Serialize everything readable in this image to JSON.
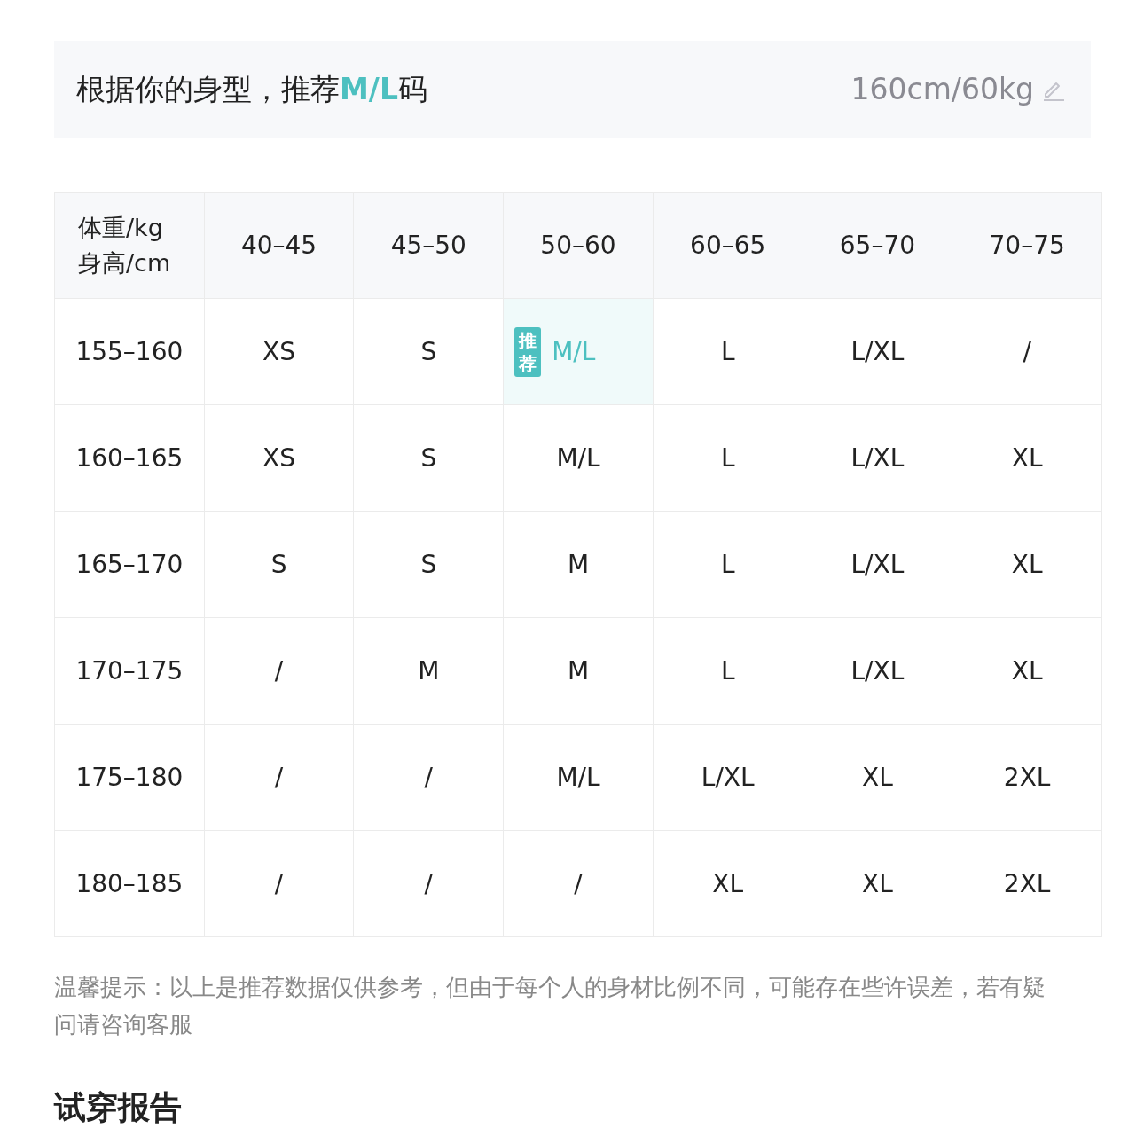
{
  "recommendation": {
    "text": "根据你的身型，推荐**M/L**码",
    "body": "160cm/60kg"
  },
  "size_table": {
    "corner": [
      "体重/kg",
      "身高/cm"
    ],
    "columns": [
      "40–45",
      "45–50",
      "50–60",
      "60–65",
      "65–70",
      "70–75"
    ],
    "recommend_badge": "推荐",
    "rows": [
      {
        "height": "155–160",
        "cells": [
          {
            "size": "XS",
            "recommended": false
          },
          {
            "size": "S",
            "recommended": false
          },
          {
            "size": "M/L",
            "recommended": true
          },
          {
            "size": "L",
            "recommended": false
          },
          {
            "size": "L/XL",
            "recommended": false
          },
          {
            "size": "/",
            "recommended": false
          }
        ]
      },
      {
        "height": "160–165",
        "cells": [
          {
            "size": "XS",
            "recommended": false
          },
          {
            "size": "S",
            "recommended": false
          },
          {
            "size": "M/L",
            "recommended": false
          },
          {
            "size": "L",
            "recommended": false
          },
          {
            "size": "L/XL",
            "recommended": false
          },
          {
            "size": "XL",
            "recommended": false
          }
        ]
      },
      {
        "height": "165–170",
        "cells": [
          {
            "size": "S",
            "recommended": false
          },
          {
            "size": "S",
            "recommended": false
          },
          {
            "size": "M",
            "recommended": false
          },
          {
            "size": "L",
            "recommended": false
          },
          {
            "size": "L/XL",
            "recommended": false
          },
          {
            "size": "XL",
            "recommended": false
          }
        ]
      },
      {
        "height": "170–175",
        "cells": [
          {
            "size": "/",
            "recommended": false
          },
          {
            "size": "M",
            "recommended": false
          },
          {
            "size": "M",
            "recommended": false
          },
          {
            "size": "L",
            "recommended": false
          },
          {
            "size": "L/XL",
            "recommended": false
          },
          {
            "size": "XL",
            "recommended": false
          }
        ]
      },
      {
        "height": "175–180",
        "cells": [
          {
            "size": "/",
            "recommended": false
          },
          {
            "size": "/",
            "recommended": false
          },
          {
            "size": "M/L",
            "recommended": false
          },
          {
            "size": "L/XL",
            "recommended": false
          },
          {
            "size": "XL",
            "recommended": false
          },
          {
            "size": "2XL",
            "recommended": false
          }
        ]
      },
      {
        "height": "180–185",
        "cells": [
          {
            "size": "/",
            "recommended": false
          },
          {
            "size": "/",
            "recommended": false
          },
          {
            "size": "/",
            "recommended": false
          },
          {
            "size": "XL",
            "recommended": false
          },
          {
            "size": "XL",
            "recommended": false
          },
          {
            "size": "2XL",
            "recommended": false
          }
        ]
      }
    ]
  },
  "note": "温馨提示：以上是推荐数据仅供参考，但由于每个人的身材比例不同，可能存在些许误差，若有疑问请咨询客服",
  "section_title": "试穿报告"
}
